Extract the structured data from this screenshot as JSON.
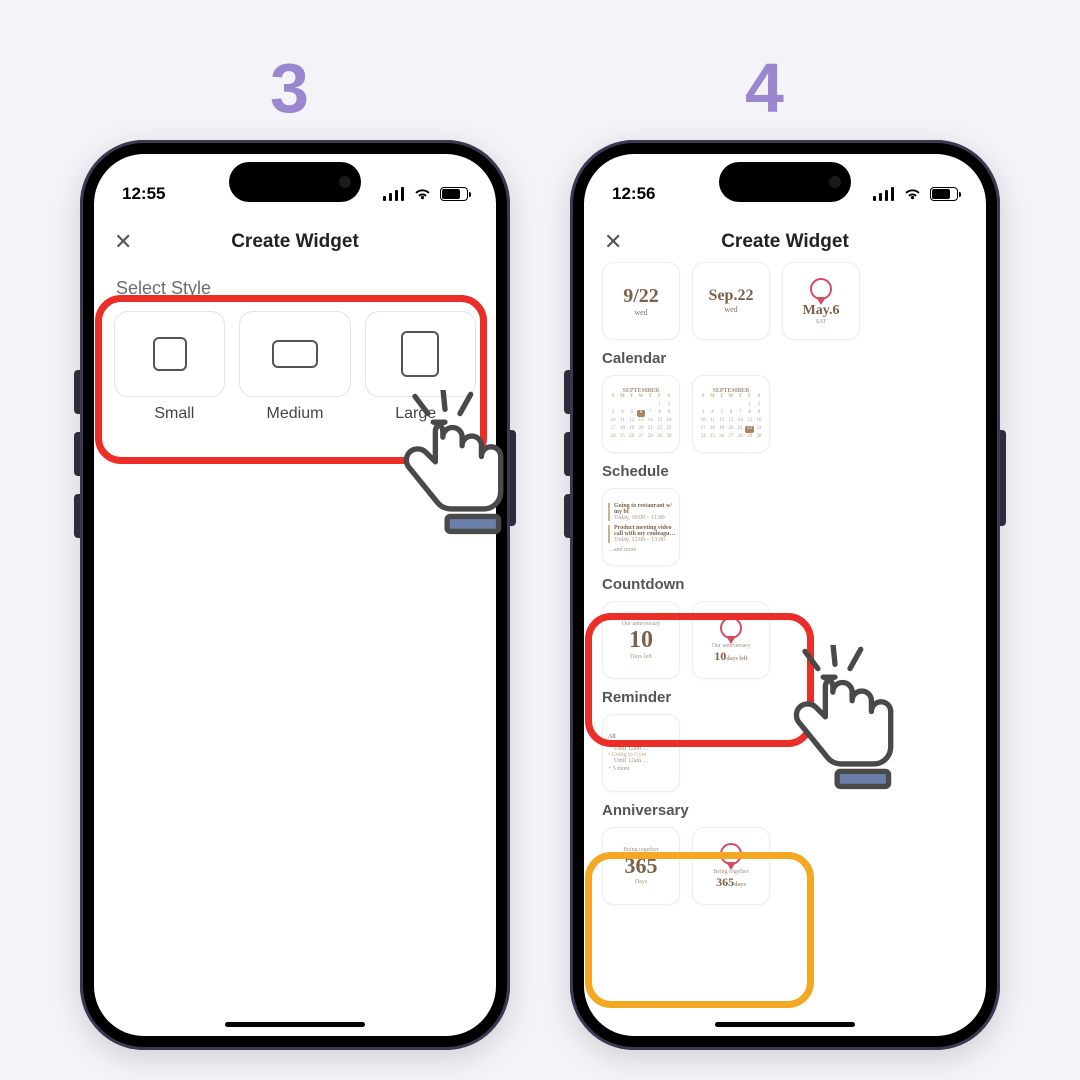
{
  "steps": {
    "s3": "3",
    "s4": "4"
  },
  "status": {
    "t3": "12:55",
    "t4": "12:56"
  },
  "page": {
    "title": "Create Widget"
  },
  "style": {
    "heading": "Select Style",
    "small": "Small",
    "medium": "Medium",
    "large": "Large"
  },
  "dates": {
    "d1_top": "9/22",
    "d1_sub": "wed",
    "d2_top": "Sep.22",
    "d2_sub": "wed",
    "d3_top": "May.6",
    "d3_sub": "SAT"
  },
  "cat": {
    "calendar": "Calendar",
    "schedule": "Schedule",
    "countdown": "Countdown",
    "reminder": "Reminder",
    "anniversary": "Anniversary"
  },
  "calendar": {
    "month": "SEPTEMBER",
    "dow": [
      "S",
      "M",
      "T",
      "W",
      "T",
      "F",
      "S"
    ]
  },
  "schedule": {
    "a_title": "Going to restaurant w/ my bf",
    "a_time": "Today, 10:00 – 11:00",
    "b_title": "Product meeting video call with my couleagu…",
    "b_time": "Today, 12:00 – 13:00",
    "more": "…and more"
  },
  "countdown": {
    "label": "Our anniversary",
    "num": "10",
    "unit": "Days left",
    "sm_num": "10",
    "sm_unit": "days left"
  },
  "reminder": {
    "all": "All",
    "item": "Going to Gym",
    "until": "Until 12am …",
    "more": "+ 5 more"
  },
  "anni": {
    "label": "Being together",
    "num": "365",
    "unit": "Days",
    "sm_num": "365",
    "sm_unit": "days"
  }
}
